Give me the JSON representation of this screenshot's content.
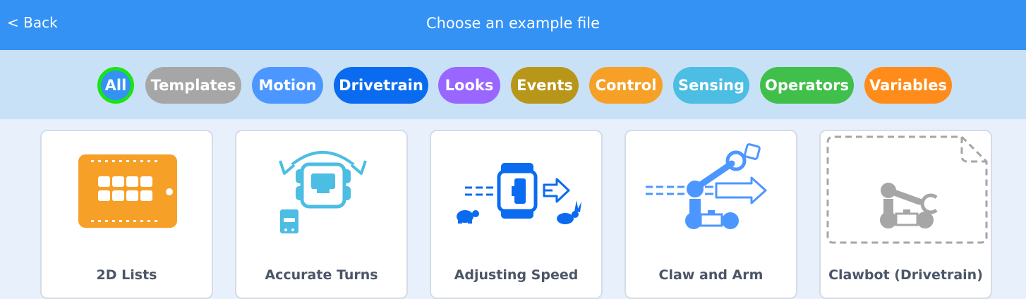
{
  "header": {
    "back_label": "< Back",
    "title": "Choose an example file",
    "background": "#3492f5"
  },
  "filters": [
    {
      "label": "All",
      "color": "#3492f5",
      "selected": true
    },
    {
      "label": "Templates",
      "color": "#a6a6a6"
    },
    {
      "label": "Motion",
      "color": "#4c97ff"
    },
    {
      "label": "Drivetrain",
      "color": "#0b6bf0"
    },
    {
      "label": "Looks",
      "color": "#9966ff"
    },
    {
      "label": "Events",
      "color": "#b8961a"
    },
    {
      "label": "Control",
      "color": "#f7a028"
    },
    {
      "label": "Sensing",
      "color": "#4cbde3"
    },
    {
      "label": "Operators",
      "color": "#40bf4a"
    },
    {
      "label": "Variables",
      "color": "#ff8c1a"
    }
  ],
  "examples": [
    {
      "label": "2D Lists",
      "icon": "grid-list-icon"
    },
    {
      "label": "Accurate Turns",
      "icon": "robot-turn-icon"
    },
    {
      "label": "Adjusting Speed",
      "icon": "speed-robot-icon"
    },
    {
      "label": "Claw and Arm",
      "icon": "robot-arm-icon"
    },
    {
      "label": "Clawbot (Drivetrain)",
      "icon": "clawbot-template-icon"
    }
  ]
}
